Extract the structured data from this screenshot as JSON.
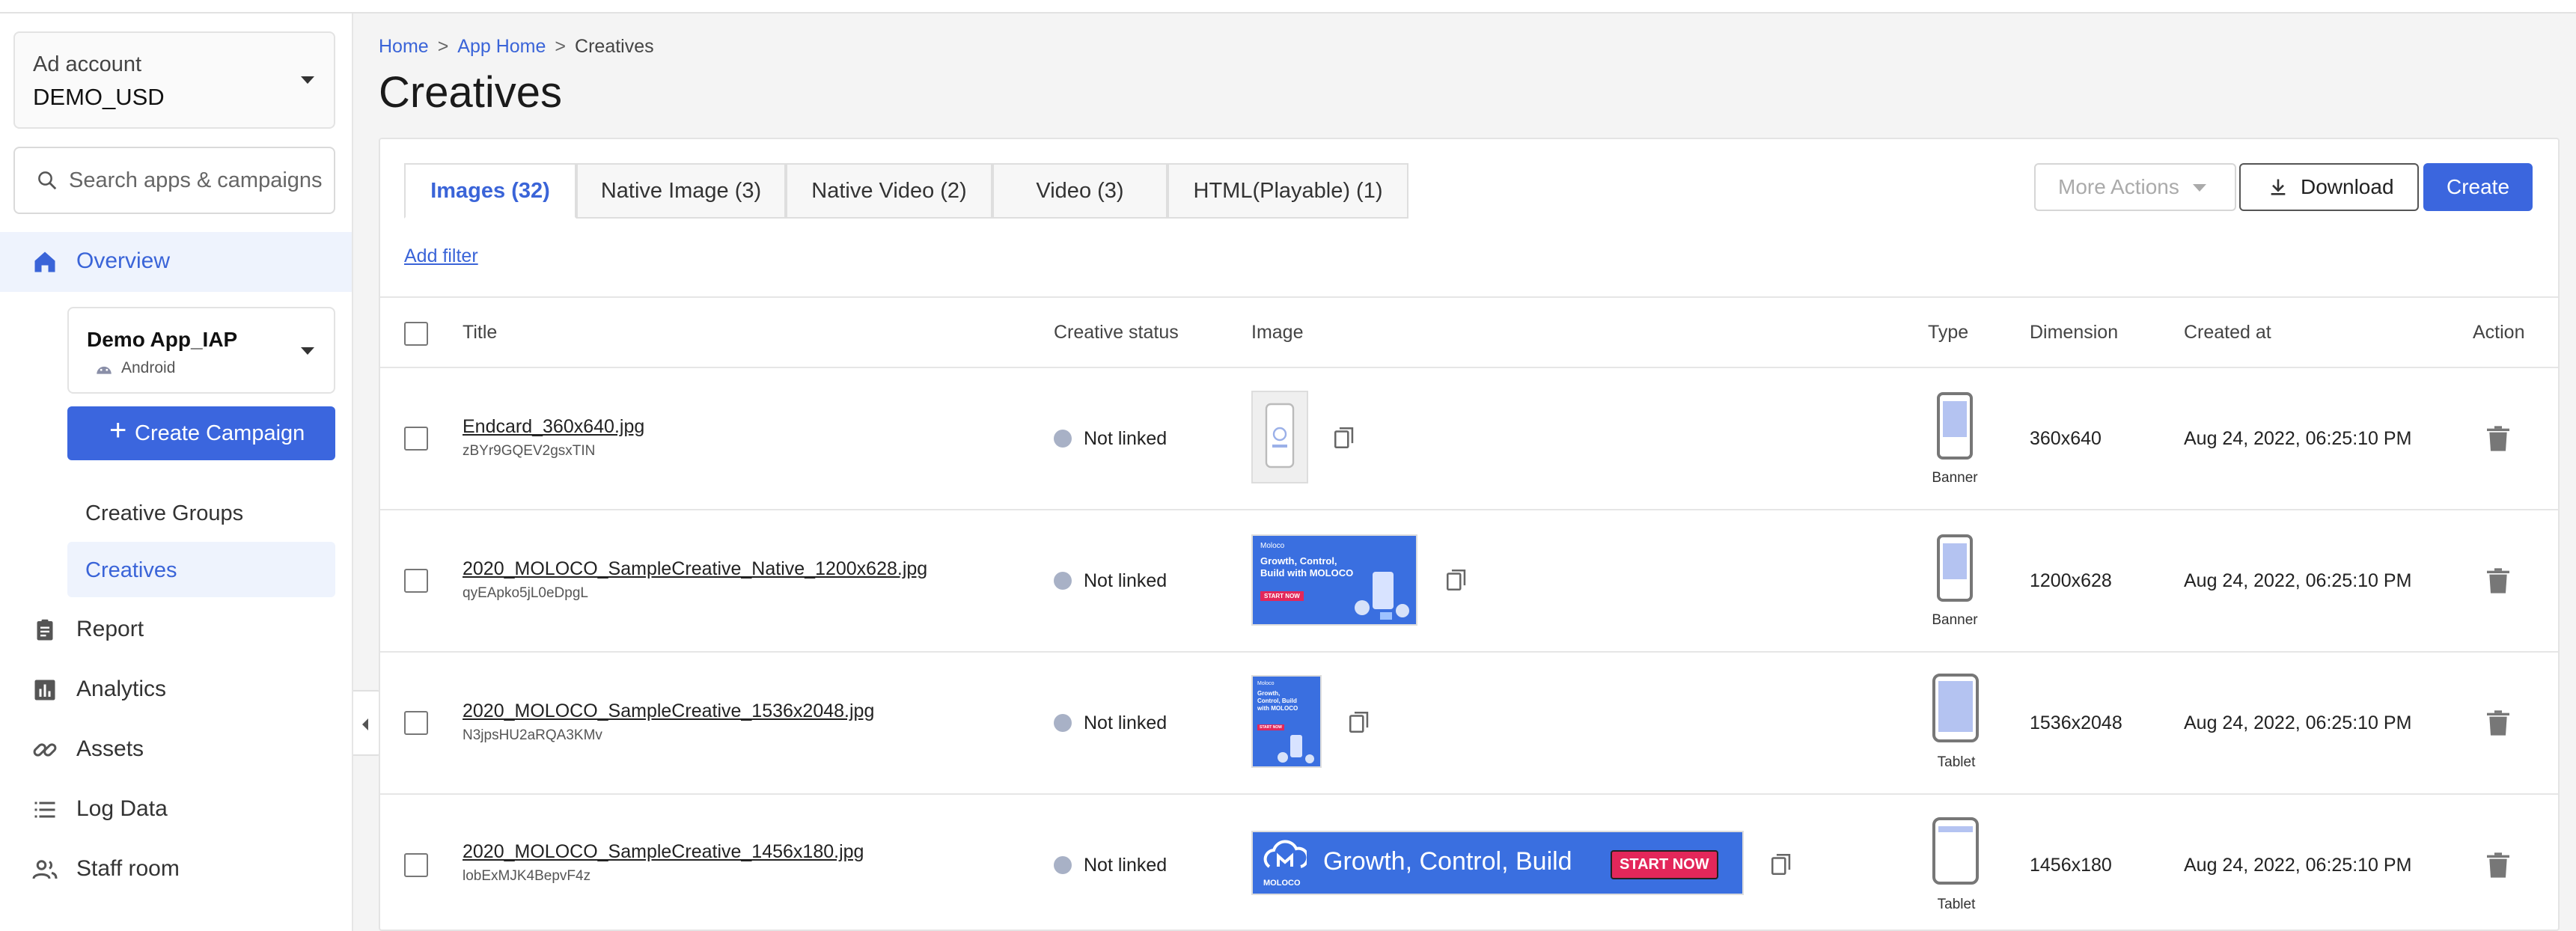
{
  "sidebar": {
    "account": {
      "label": "Ad account",
      "value": "DEMO_USD"
    },
    "search_placeholder": "Search apps & campaigns",
    "overview": "Overview",
    "app": {
      "name": "Demo App_IAP",
      "platform": "Android"
    },
    "create_campaign": "Create Campaign",
    "creative_groups": "Creative Groups",
    "creatives": "Creatives",
    "report": "Report",
    "analytics": "Analytics",
    "assets": "Assets",
    "log_data": "Log Data",
    "staff_room": "Staff room"
  },
  "breadcrumb": {
    "home": "Home",
    "sep": ">",
    "app_home": "App Home",
    "current": "Creatives"
  },
  "page_title": "Creatives",
  "tabs": [
    {
      "label": "Images (32)"
    },
    {
      "label": "Native Image (3)"
    },
    {
      "label": "Native Video (2)"
    },
    {
      "label": "Video (3)"
    },
    {
      "label": "HTML(Playable) (1)"
    }
  ],
  "actions": {
    "more": "More Actions",
    "download": "Download",
    "create": "Create"
  },
  "add_filter": "Add filter",
  "columns": {
    "title": "Title",
    "status": "Creative status",
    "image": "Image",
    "type": "Type",
    "dimension": "Dimension",
    "created": "Created at",
    "action": "Action"
  },
  "rows": [
    {
      "title": "Endcard_360x640.jpg",
      "id": "zBYr9GQEV2gsxTIN",
      "status": "Not linked",
      "type": "Banner",
      "dimension": "360x640",
      "created": "Aug 24, 2022, 06:25:10 PM"
    },
    {
      "title": "2020_MOLOCO_SampleCreative_Native_1200x628.jpg",
      "id": "qyEApko5jL0eDpgL",
      "status": "Not linked",
      "type": "Banner",
      "dimension": "1200x628",
      "created": "Aug 24, 2022, 06:25:10 PM"
    },
    {
      "title": "2020_MOLOCO_SampleCreative_1536x2048.jpg",
      "id": "N3jpsHU2aRQA3KMv",
      "status": "Not linked",
      "type": "Tablet",
      "dimension": "1536x2048",
      "created": "Aug 24, 2022, 06:25:10 PM"
    },
    {
      "title": "2020_MOLOCO_SampleCreative_1456x180.jpg",
      "id": "lobExMJK4BepvF4z",
      "status": "Not linked",
      "type": "Tablet",
      "dimension": "1456x180",
      "created": "Aug 24, 2022, 06:25:10 PM"
    }
  ],
  "thumbs": {
    "native_text": "Growth, Control, Build with MOLOCO",
    "start_now": "START NOW",
    "tablet_text": "Growth, Control, Build with MOLOCO",
    "banner_logo": "MOLOCO",
    "banner_text": "Growth, Control, Build",
    "brand": "Moloco"
  },
  "colors": {
    "accent": "#3b66de",
    "status_dot": "#a8b1c6"
  }
}
